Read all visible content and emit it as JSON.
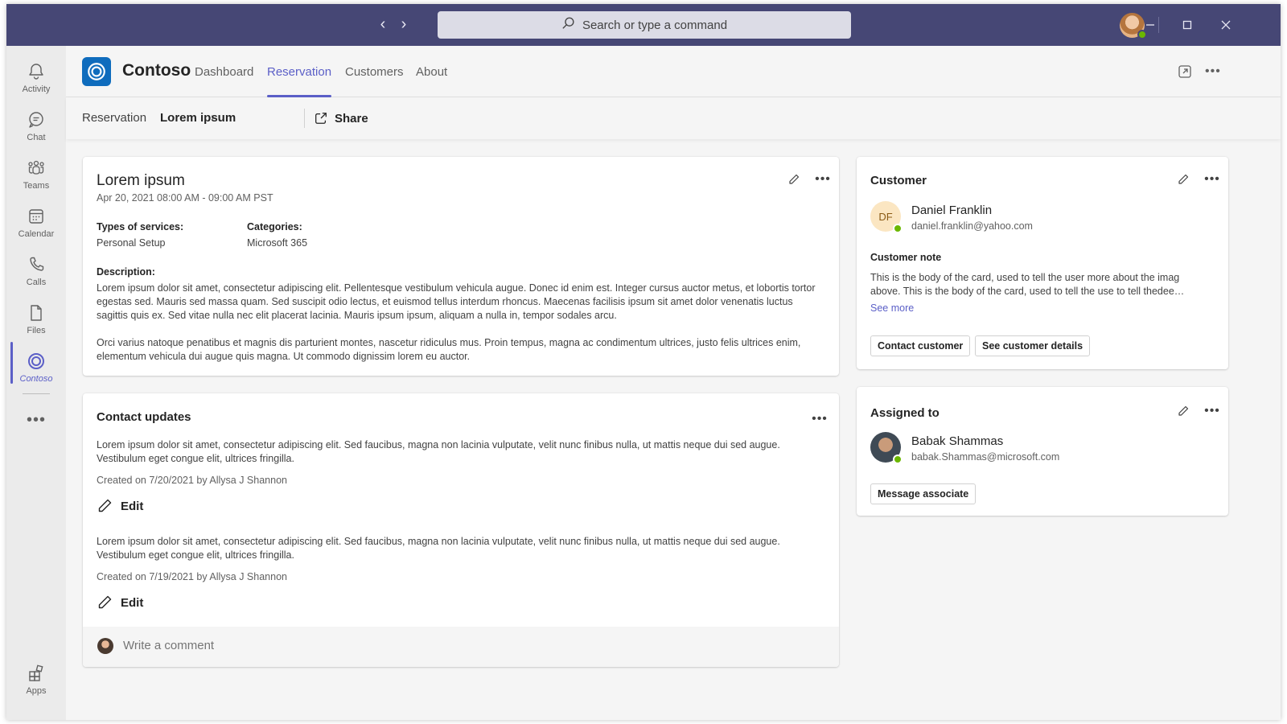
{
  "titlebar": {
    "search_placeholder": "Search or type a command",
    "back_icon": "chevron-left-icon",
    "forward_icon": "chevron-right-icon"
  },
  "rail": {
    "items": [
      {
        "label": "Activity",
        "icon": "bell-icon"
      },
      {
        "label": "Chat",
        "icon": "chat-icon"
      },
      {
        "label": "Teams",
        "icon": "teams-icon"
      },
      {
        "label": "Calendar",
        "icon": "calendar-icon"
      },
      {
        "label": "Calls",
        "icon": "phone-icon"
      },
      {
        "label": "Files",
        "icon": "file-icon"
      },
      {
        "label": "Contoso",
        "icon": "contoso-icon"
      },
      {
        "label": "Apps",
        "icon": "apps-icon"
      }
    ],
    "more": "•••",
    "active": "Contoso"
  },
  "app": {
    "name": "Contoso",
    "tabs": [
      "Dashboard",
      "Reservation",
      "Customers",
      "About"
    ],
    "active_tab": "Reservation"
  },
  "breadcrumb": {
    "parent": "Reservation",
    "separator": "›",
    "current": "Lorem ipsum",
    "share_label": "Share"
  },
  "reservation": {
    "title": "Lorem ipsum",
    "datetime": "Apr 20, 2021 08:00 AM - 09:00 AM PST",
    "services_label": "Types of services:",
    "services_value": "Personal Setup",
    "categories_label": "Categories:",
    "categories_value": "Microsoft 365",
    "description_label": "Description:",
    "description_p1": "Lorem ipsum dolor sit amet, consectetur adipiscing elit. Pellentesque vestibulum vehicula augue. Donec id enim est. Integer cursus auctor metus, et lobortis tortor egestas sed. Mauris sed massa quam. Sed suscipit odio lectus, et euismod tellus interdum rhoncus. Maecenas facilisis ipsum sit amet dolor venenatis luctus sagittis quis ex. Sed vitae nulla nec elit placerat lacinia. Mauris ipsum ipsum, aliquam a nulla in, tempor sodales arcu.",
    "description_p2": "Orci varius natoque penatibus et magnis dis parturient montes, nascetur ridiculus mus. Proin tempus, magna ac condimentum ultrices, justo felis ultrices enim, elementum vehicula dui augue quis magna. Ut commodo dignissim lorem eu auctor."
  },
  "contact_updates": {
    "title": "Contact updates",
    "entries": [
      {
        "text": "Lorem ipsum dolor sit amet, consectetur adipiscing elit. Sed faucibus, magna non lacinia vulputate, velit nunc finibus nulla, ut mattis neque dui sed augue. Vestibulum eget congue elit, ultrices fringilla.",
        "meta": "Created on 7/20/2021 by Allysa J Shannon",
        "edit_label": "Edit"
      },
      {
        "text": "Lorem ipsum dolor sit amet, consectetur adipiscing elit. Sed faucibus, magna non lacinia vulputate, velit nunc finibus nulla, ut mattis neque dui sed augue. Vestibulum eget congue elit, ultrices fringilla.",
        "meta": "Created on 7/19/2021 by Allysa J Shannon",
        "edit_label": "Edit"
      }
    ],
    "comment_placeholder": "Write a comment"
  },
  "customer": {
    "title": "Customer",
    "initials": "DF",
    "name": "Daniel Franklin",
    "email": "daniel.franklin@yahoo.com",
    "note_label": "Customer note",
    "note_text": "This is the body of the card, used to tell the user more about the imag above. This is the body of the card, used to tell the use to tell thedee…",
    "see_more": "See more",
    "contact_button": "Contact customer",
    "details_button": "See customer details"
  },
  "assigned": {
    "title": "Assigned to",
    "name": "Babak Shammas",
    "email": "babak.Shammas@microsoft.com",
    "message_button": "Message associate"
  },
  "colors": {
    "titlebar": "#464775",
    "accent": "#5b5fc7",
    "app_logo": "#0f6cbd",
    "presence_available": "#6bb700"
  }
}
